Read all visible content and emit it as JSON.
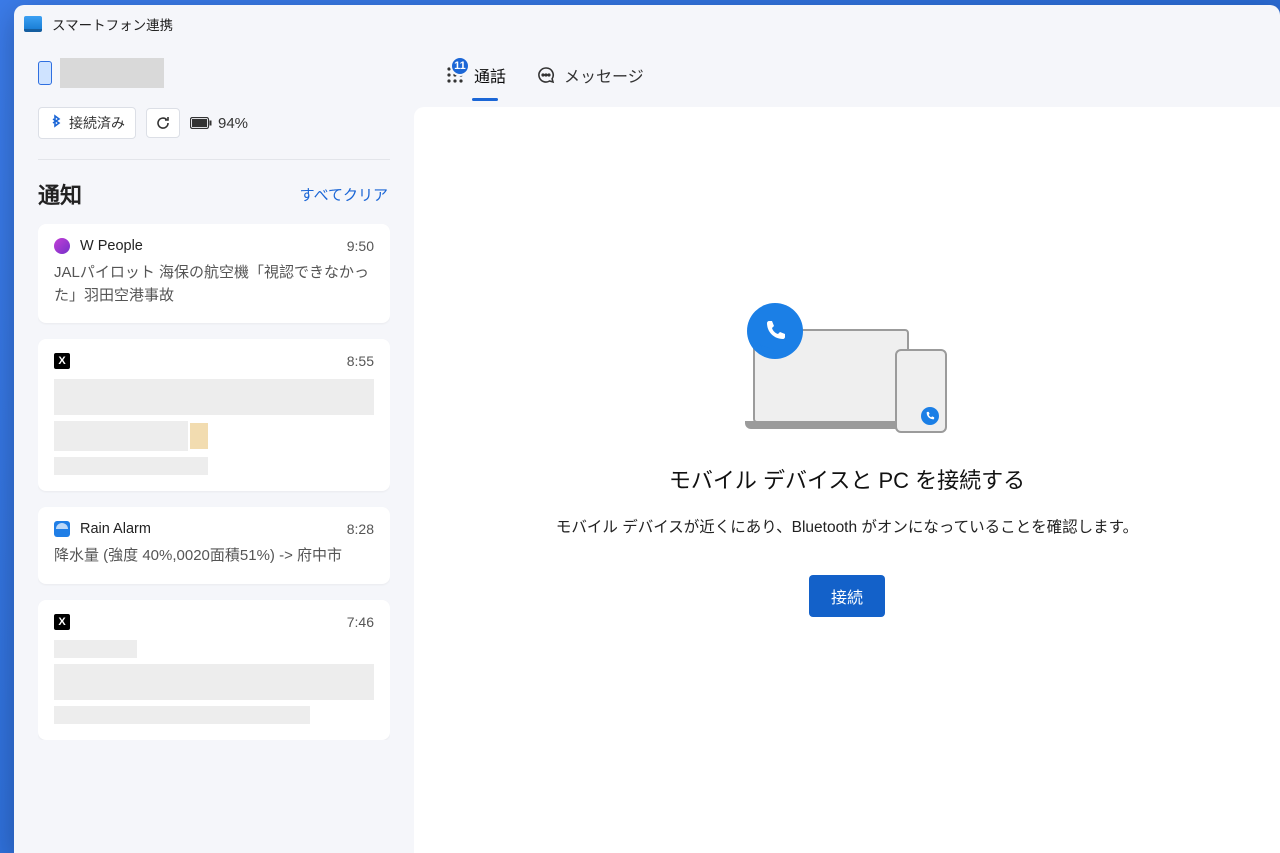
{
  "app": {
    "title": "スマートフォン連携"
  },
  "sidebar": {
    "bluetooth_label": "接続済み",
    "battery": "94%",
    "notifications_title": "通知",
    "clear_all": "すべてクリア",
    "cards": [
      {
        "app": "W People",
        "time": "9:50",
        "body": "JALパイロット 海保の航空機「視認できなかった」羽田空港事故"
      },
      {
        "app": "",
        "time": "8:55",
        "body": ""
      },
      {
        "app": "Rain Alarm",
        "time": "8:28",
        "body": "降水量 (強度 40%,0020面積51%) -> 府中市"
      },
      {
        "app": "",
        "time": "7:46",
        "body": ""
      }
    ]
  },
  "tabs": {
    "calls": {
      "label": "通話",
      "badge": "11"
    },
    "messages": {
      "label": "メッセージ"
    }
  },
  "main": {
    "title": "モバイル デバイスと PC を接続する",
    "subtitle": "モバイル デバイスが近くにあり、Bluetooth がオンになっていることを確認します。",
    "connect_label": "接続"
  }
}
